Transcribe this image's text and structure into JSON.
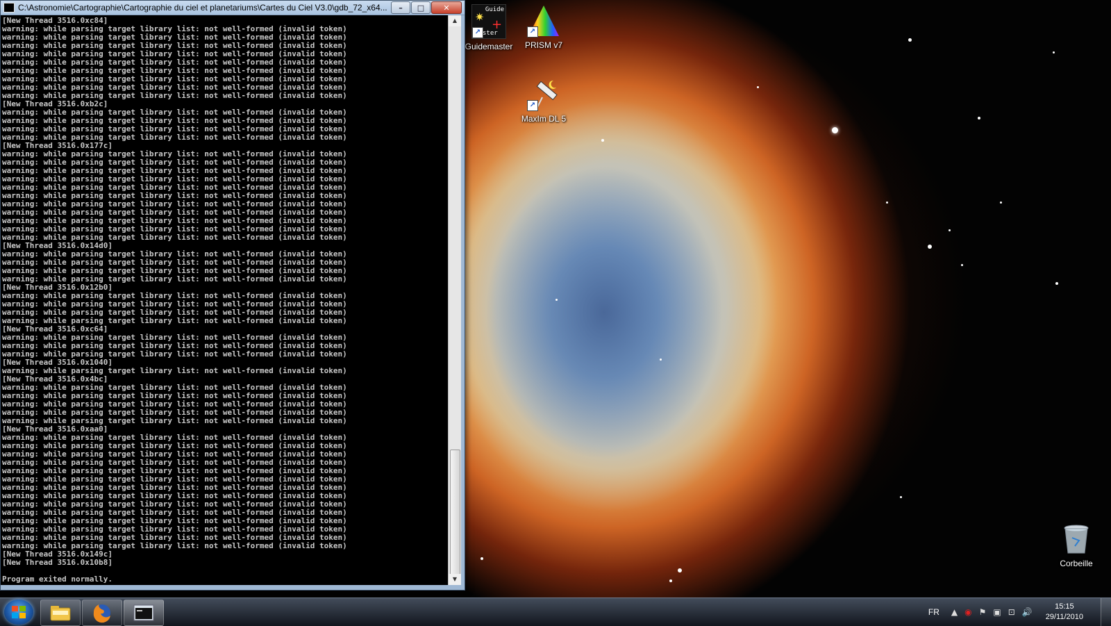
{
  "window": {
    "title": "C:\\Astronomie\\Cartographie\\Cartographie du ciel et planetariums\\Cartes du Ciel V3.0\\gdb_72_x64...",
    "controls": {
      "minimize": "–",
      "maximize": "□",
      "close": "✕"
    }
  },
  "console": {
    "lines": [
      "[New Thread 3516.0xc84]",
      "warning: while parsing target library list: not well-formed (invalid token)",
      "warning: while parsing target library list: not well-formed (invalid token)",
      "warning: while parsing target library list: not well-formed (invalid token)",
      "warning: while parsing target library list: not well-formed (invalid token)",
      "warning: while parsing target library list: not well-formed (invalid token)",
      "warning: while parsing target library list: not well-formed (invalid token)",
      "warning: while parsing target library list: not well-formed (invalid token)",
      "warning: while parsing target library list: not well-formed (invalid token)",
      "warning: while parsing target library list: not well-formed (invalid token)",
      "[New Thread 3516.0xb2c]",
      "warning: while parsing target library list: not well-formed (invalid token)",
      "warning: while parsing target library list: not well-formed (invalid token)",
      "warning: while parsing target library list: not well-formed (invalid token)",
      "warning: while parsing target library list: not well-formed (invalid token)",
      "[New Thread 3516.0x177c]",
      "warning: while parsing target library list: not well-formed (invalid token)",
      "warning: while parsing target library list: not well-formed (invalid token)",
      "warning: while parsing target library list: not well-formed (invalid token)",
      "warning: while parsing target library list: not well-formed (invalid token)",
      "warning: while parsing target library list: not well-formed (invalid token)",
      "warning: while parsing target library list: not well-formed (invalid token)",
      "warning: while parsing target library list: not well-formed (invalid token)",
      "warning: while parsing target library list: not well-formed (invalid token)",
      "warning: while parsing target library list: not well-formed (invalid token)",
      "warning: while parsing target library list: not well-formed (invalid token)",
      "warning: while parsing target library list: not well-formed (invalid token)",
      "[New Thread 3516.0x14d0]",
      "warning: while parsing target library list: not well-formed (invalid token)",
      "warning: while parsing target library list: not well-formed (invalid token)",
      "warning: while parsing target library list: not well-formed (invalid token)",
      "warning: while parsing target library list: not well-formed (invalid token)",
      "[New Thread 3516.0x12b0]",
      "warning: while parsing target library list: not well-formed (invalid token)",
      "warning: while parsing target library list: not well-formed (invalid token)",
      "warning: while parsing target library list: not well-formed (invalid token)",
      "warning: while parsing target library list: not well-formed (invalid token)",
      "[New Thread 3516.0xc64]",
      "warning: while parsing target library list: not well-formed (invalid token)",
      "warning: while parsing target library list: not well-formed (invalid token)",
      "warning: while parsing target library list: not well-formed (invalid token)",
      "[New Thread 3516.0x1040]",
      "warning: while parsing target library list: not well-formed (invalid token)",
      "[New Thread 3516.0x4bc]",
      "warning: while parsing target library list: not well-formed (invalid token)",
      "warning: while parsing target library list: not well-formed (invalid token)",
      "warning: while parsing target library list: not well-formed (invalid token)",
      "warning: while parsing target library list: not well-formed (invalid token)",
      "warning: while parsing target library list: not well-formed (invalid token)",
      "[New Thread 3516.0xaa0]",
      "warning: while parsing target library list: not well-formed (invalid token)",
      "warning: while parsing target library list: not well-formed (invalid token)",
      "warning: while parsing target library list: not well-formed (invalid token)",
      "warning: while parsing target library list: not well-formed (invalid token)",
      "warning: while parsing target library list: not well-formed (invalid token)",
      "warning: while parsing target library list: not well-formed (invalid token)",
      "warning: while parsing target library list: not well-formed (invalid token)",
      "warning: while parsing target library list: not well-formed (invalid token)",
      "warning: while parsing target library list: not well-formed (invalid token)",
      "warning: while parsing target library list: not well-formed (invalid token)",
      "warning: while parsing target library list: not well-formed (invalid token)",
      "warning: while parsing target library list: not well-formed (invalid token)",
      "warning: while parsing target library list: not well-formed (invalid token)",
      "warning: while parsing target library list: not well-formed (invalid token)",
      "[New Thread 3516.0x149c]",
      "[New Thread 3516.0x10b8]",
      "",
      "Program exited normally."
    ]
  },
  "desktop_icons": [
    {
      "label": "Guidemaster",
      "image_text_top": "Guide",
      "image_text_bottom": "ster",
      "icon": "guidemaster-icon"
    },
    {
      "label": "PRISM v7",
      "icon": "prism-icon"
    },
    {
      "label": "MaxIm DL 5",
      "icon": "telescope-icon"
    },
    {
      "label": "Corbeille",
      "icon": "recycle-bin-icon"
    }
  ],
  "taskbar": {
    "pinned": [
      "explorer-icon",
      "firefox-icon",
      "console-icon"
    ],
    "language": "FR",
    "clock_time": "15:15",
    "clock_date": "29/11/2010",
    "tray_icons": [
      "show-hidden-icon",
      "antivirus-icon",
      "action-center-flag-icon",
      "device-icon",
      "network-icon",
      "volume-icon"
    ]
  },
  "colors": {
    "console_bg": "#000000",
    "console_text": "#c9c9c9",
    "title_bar": "#b9cfe8",
    "close_button": "#c7402a"
  }
}
